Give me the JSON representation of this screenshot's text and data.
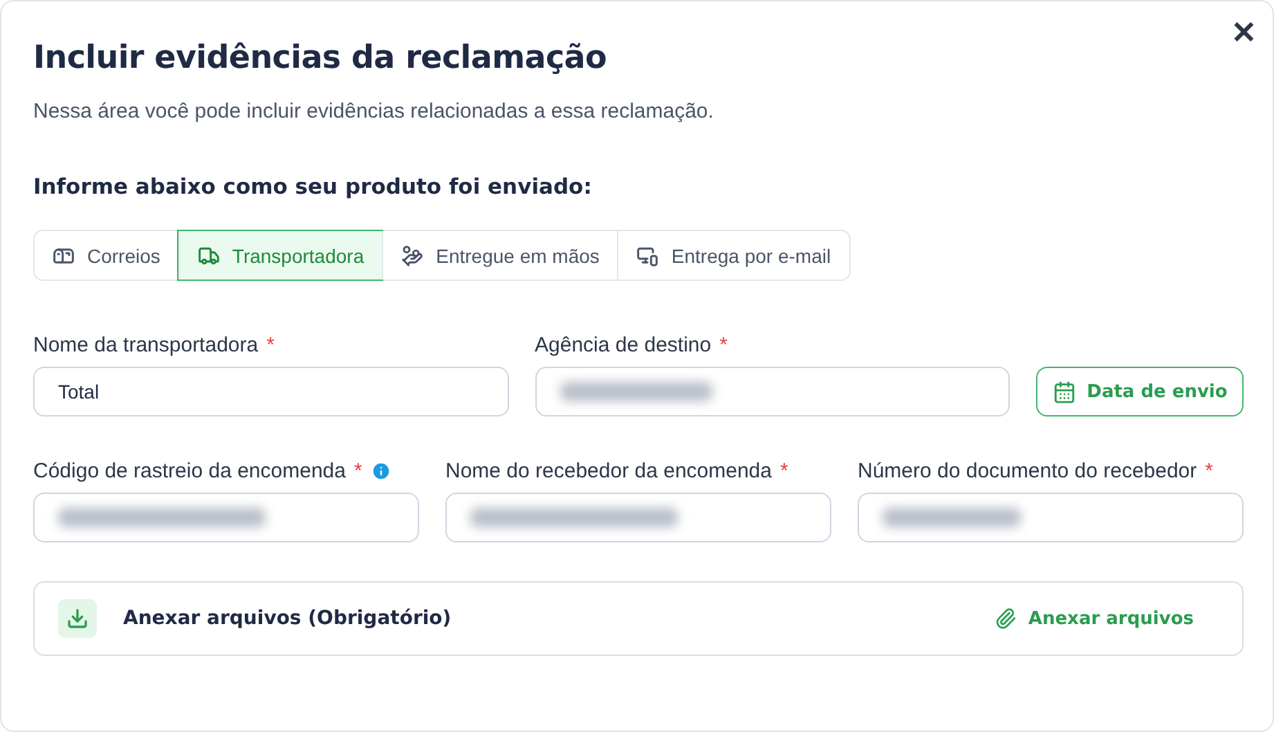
{
  "dialog": {
    "title": "Incluir evidências da reclamação",
    "close": "✕",
    "subtitle": "Nessa área você pode incluir evidências relacionadas a essa reclamação."
  },
  "shipping": {
    "heading": "Informe abaixo como seu produto foi enviado:",
    "options": [
      {
        "kind": "mailbox",
        "label": "Correios",
        "selected": false
      },
      {
        "kind": "truck",
        "label": "Transportadora",
        "selected": true
      },
      {
        "kind": "hand",
        "label": "Entregue em mãos",
        "selected": false
      },
      {
        "kind": "devices",
        "label": "Entrega por e-mail",
        "selected": false
      }
    ]
  },
  "fields": [
    {
      "label": "Nome da transportadora",
      "required_mark": "*",
      "value": "Total",
      "redacted": false,
      "info": false
    },
    {
      "label": "Agência de destino",
      "required_mark": "*",
      "redacted": true,
      "info": false
    },
    {
      "label": "Código de rastreio da encomenda",
      "required_mark": "*",
      "redacted": true,
      "info": true
    },
    {
      "label": "Nome do recebedor da encomenda",
      "required_mark": "*",
      "redacted": true,
      "info": false
    },
    {
      "label": "Número do documento do recebedor",
      "required_mark": "*",
      "redacted": true,
      "info": false
    }
  ],
  "date_button": "Data de envio",
  "attachments": {
    "title": "Anexar arquivos (Obrigatório)",
    "action": "Anexar arquivos"
  }
}
